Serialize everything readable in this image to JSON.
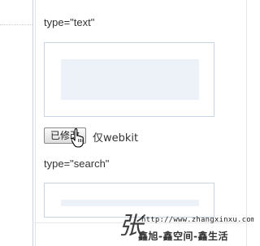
{
  "sections": [
    {
      "label": "type=\"text\""
    },
    {
      "label": "type=\"search\""
    }
  ],
  "button": {
    "label": "已修改"
  },
  "note": "仅webkit",
  "watermark": {
    "glyph": "张",
    "url": "http://www.zhangxinxu.com",
    "name": "鑫旭-鑫空间-鑫生活"
  }
}
